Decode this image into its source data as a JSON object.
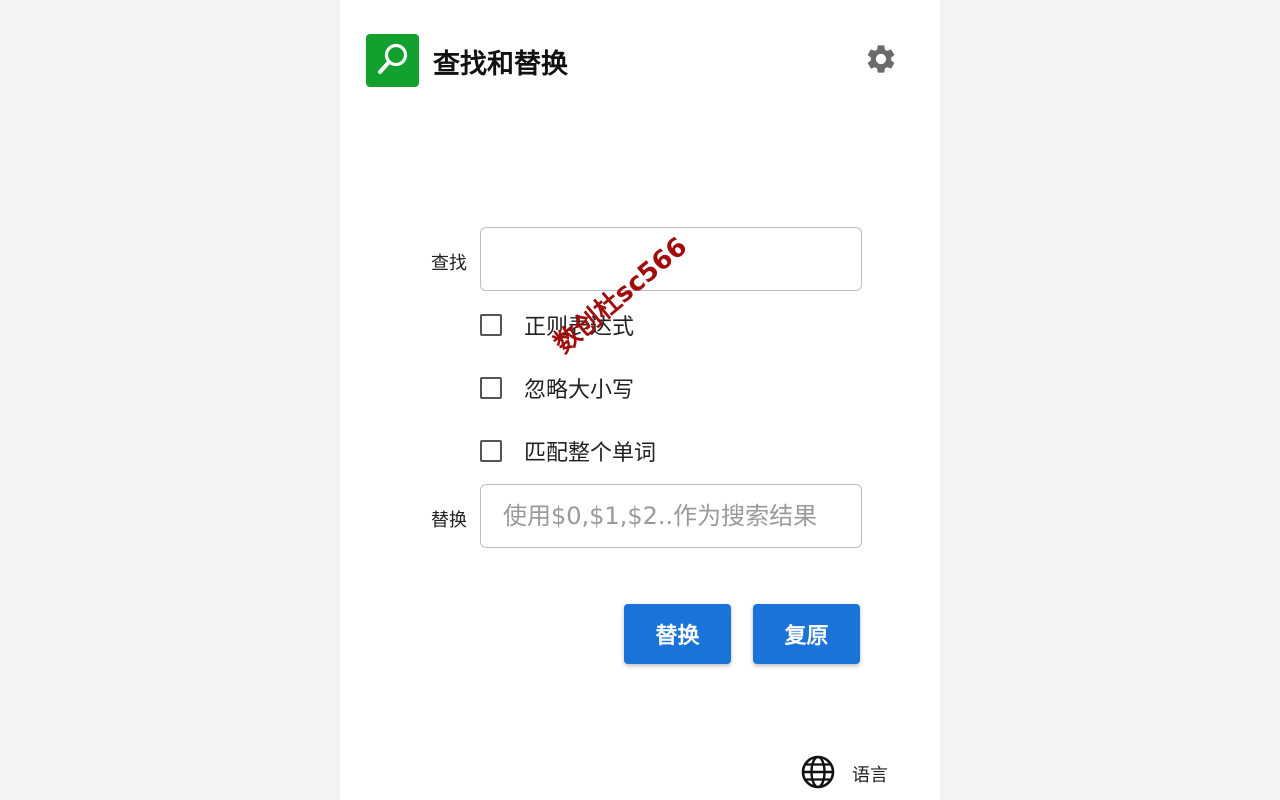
{
  "header": {
    "title": "查找和替换",
    "logo_icon": "search-icon",
    "settings_icon": "gear-icon",
    "logo_color": "#12a02f"
  },
  "find": {
    "label": "查找",
    "value": "",
    "placeholder": ""
  },
  "options": [
    {
      "label": "正则表达式",
      "checked": false
    },
    {
      "label": "忽略大小写",
      "checked": false
    },
    {
      "label": "匹配整个单词",
      "checked": false
    }
  ],
  "replace": {
    "label": "替换",
    "value": "",
    "placeholder": "使用$0,$1,$2..作为搜索结果"
  },
  "buttons": {
    "replace_label": "替换",
    "restore_label": "复原",
    "color": "#1a73d9"
  },
  "footer": {
    "language_label": "语言",
    "language_icon": "globe-icon"
  },
  "watermark": {
    "text": "数创杜sc566"
  }
}
